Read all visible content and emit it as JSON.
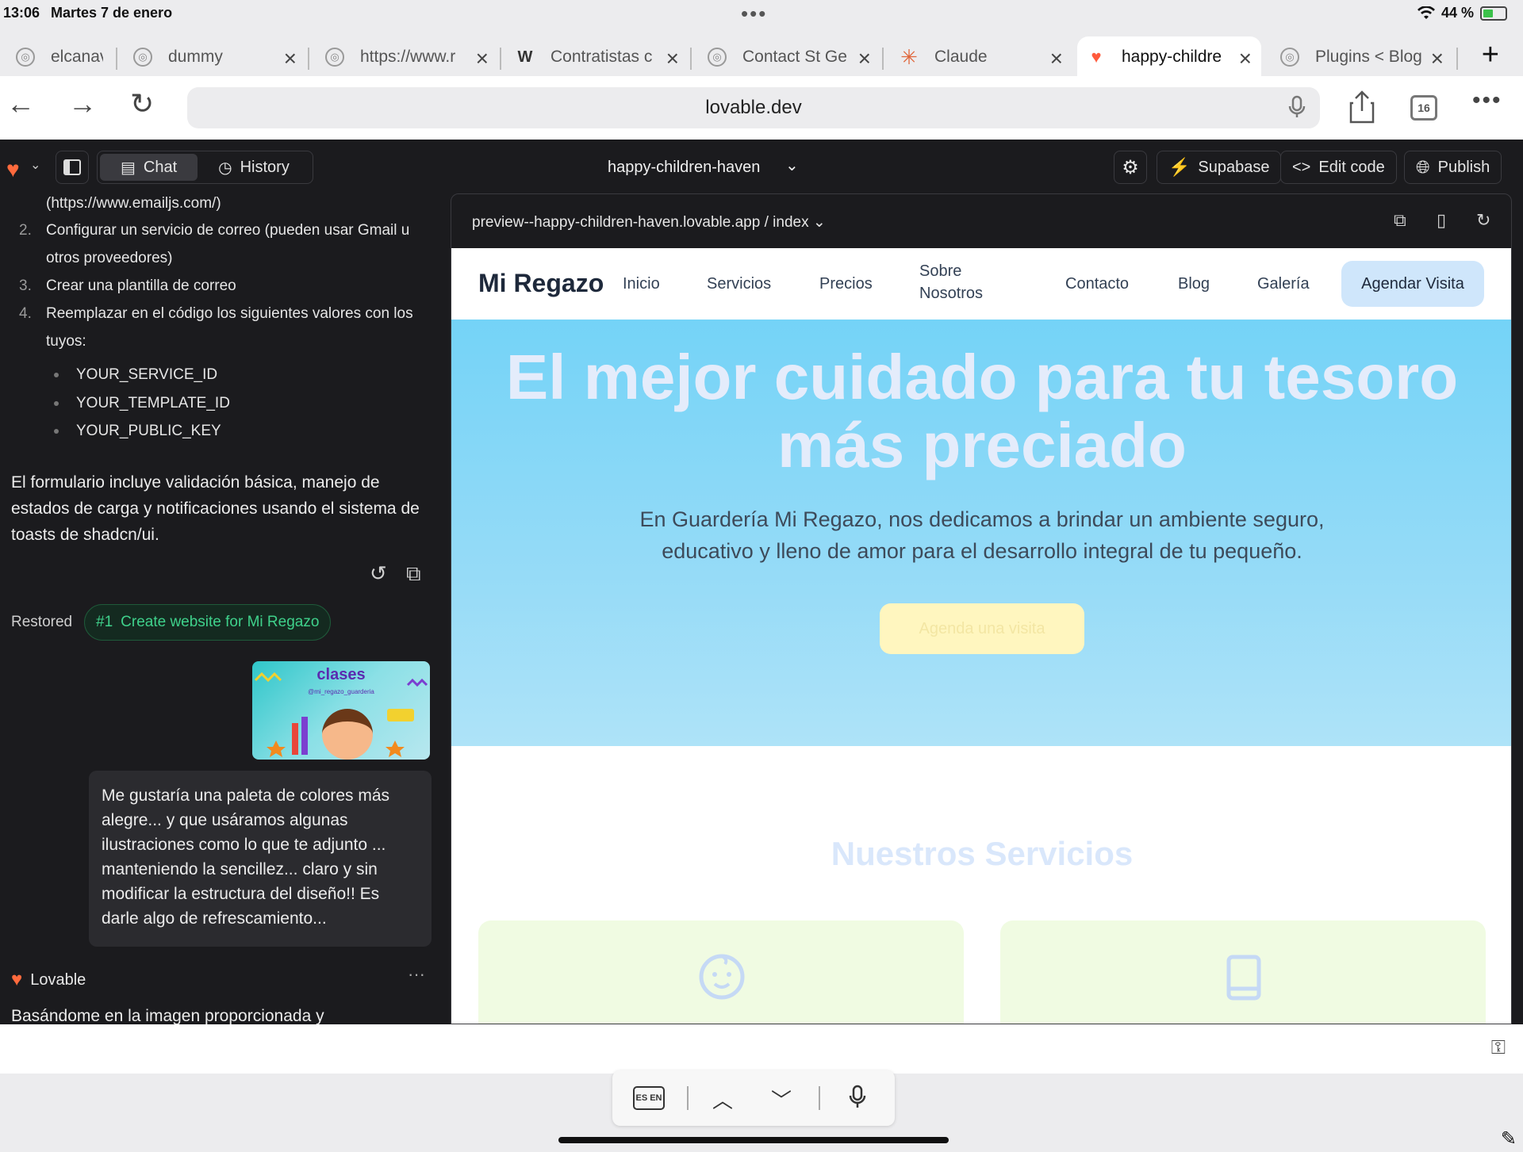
{
  "status": {
    "time": "13:06",
    "date": "Martes 7 de enero",
    "battery": "44 %"
  },
  "tabs": [
    {
      "label": "elcanav",
      "icon": "globe-icon"
    },
    {
      "label": "dummy",
      "icon": "globe-icon"
    },
    {
      "label": "https://www.r",
      "icon": "globe-icon"
    },
    {
      "label": "Contratistas c",
      "icon": "webflow-icon"
    },
    {
      "label": "Contact St Ge",
      "icon": "globe-icon"
    },
    {
      "label": "Claude",
      "icon": "claude-icon"
    },
    {
      "label": "happy-childre",
      "icon": "lovable-heart-icon",
      "active": true
    },
    {
      "label": "Plugins < Blog",
      "icon": "globe-icon"
    }
  ],
  "browser": {
    "url": "lovable.dev",
    "tab_count": "16"
  },
  "app": {
    "chat_label": "Chat",
    "history_label": "History",
    "project_name": "happy-children-haven",
    "supabase_label": "Supabase",
    "edit_code_label": "Edit code",
    "publish_label": "Publish"
  },
  "chat": {
    "line_link": "(https://www.emailjs.com/)",
    "steps": [
      {
        "num": "2.",
        "text": "Configurar un servicio de correo (pueden usar Gmail u",
        "cont": "otros proveedores)"
      },
      {
        "num": "3.",
        "text": "Crear una plantilla de correo"
      },
      {
        "num": "4.",
        "text": "Reemplazar en el código los siguientes valores con los",
        "cont": "tuyos:"
      }
    ],
    "values": [
      "YOUR_SERVICE_ID",
      "YOUR_TEMPLATE_ID",
      "YOUR_PUBLIC_KEY"
    ],
    "paragraph": "El formulario incluye validación básica, manejo de estados de carga y notificaciones usando el sistema de toasts de shadcn/ui.",
    "restored_label": "Restored",
    "restored_num": "#1",
    "restored_text": "Create website for Mi Regazo",
    "attachment_title": "clases",
    "attachment_handle": "@mi_regazo_guarderia",
    "user_message": "Me gustaría una paleta de colores más alegre... y que usáramos algunas ilustraciones como lo que te adjunto ... manteniendo la sencillez... claro y sin modificar la estructura del diseño!! Es darle algo de refrescamiento...",
    "assistant_name": "Lovable",
    "assistant_more": "···",
    "assistant_first_line": "Basándome en la imagen proporcionada y"
  },
  "preview": {
    "url": "preview--happy-children-haven.lovable.app",
    "separator": "/",
    "route": "index"
  },
  "site": {
    "brand": "Mi Regazo",
    "nav": [
      "Inicio",
      "Servicios",
      "Precios",
      "Sobre",
      "Nosotros",
      "Contacto",
      "Blog",
      "Galería"
    ],
    "cta": "Agendar Visita",
    "hero_title_1": "El mejor cuidado para tu tesoro",
    "hero_title_2": "más preciado",
    "hero_text_1": "En Guardería Mi Regazo, nos dedicamos a brindar un ambiente seguro,",
    "hero_text_2": "educativo y lleno de amor para el desarrollo integral de tu pequeño.",
    "hero_button": "Agenda una visita",
    "services_title": "Nuestros Servicios"
  },
  "keyboard": {
    "lang": "ES EN"
  },
  "colors": {
    "app_bg": "#1b1b1e",
    "hero_bg": "#74d3f7",
    "cta_bg": "#cfe6fb",
    "card_bg": "#f0fbe2",
    "restore_green": "#3fd18b"
  }
}
